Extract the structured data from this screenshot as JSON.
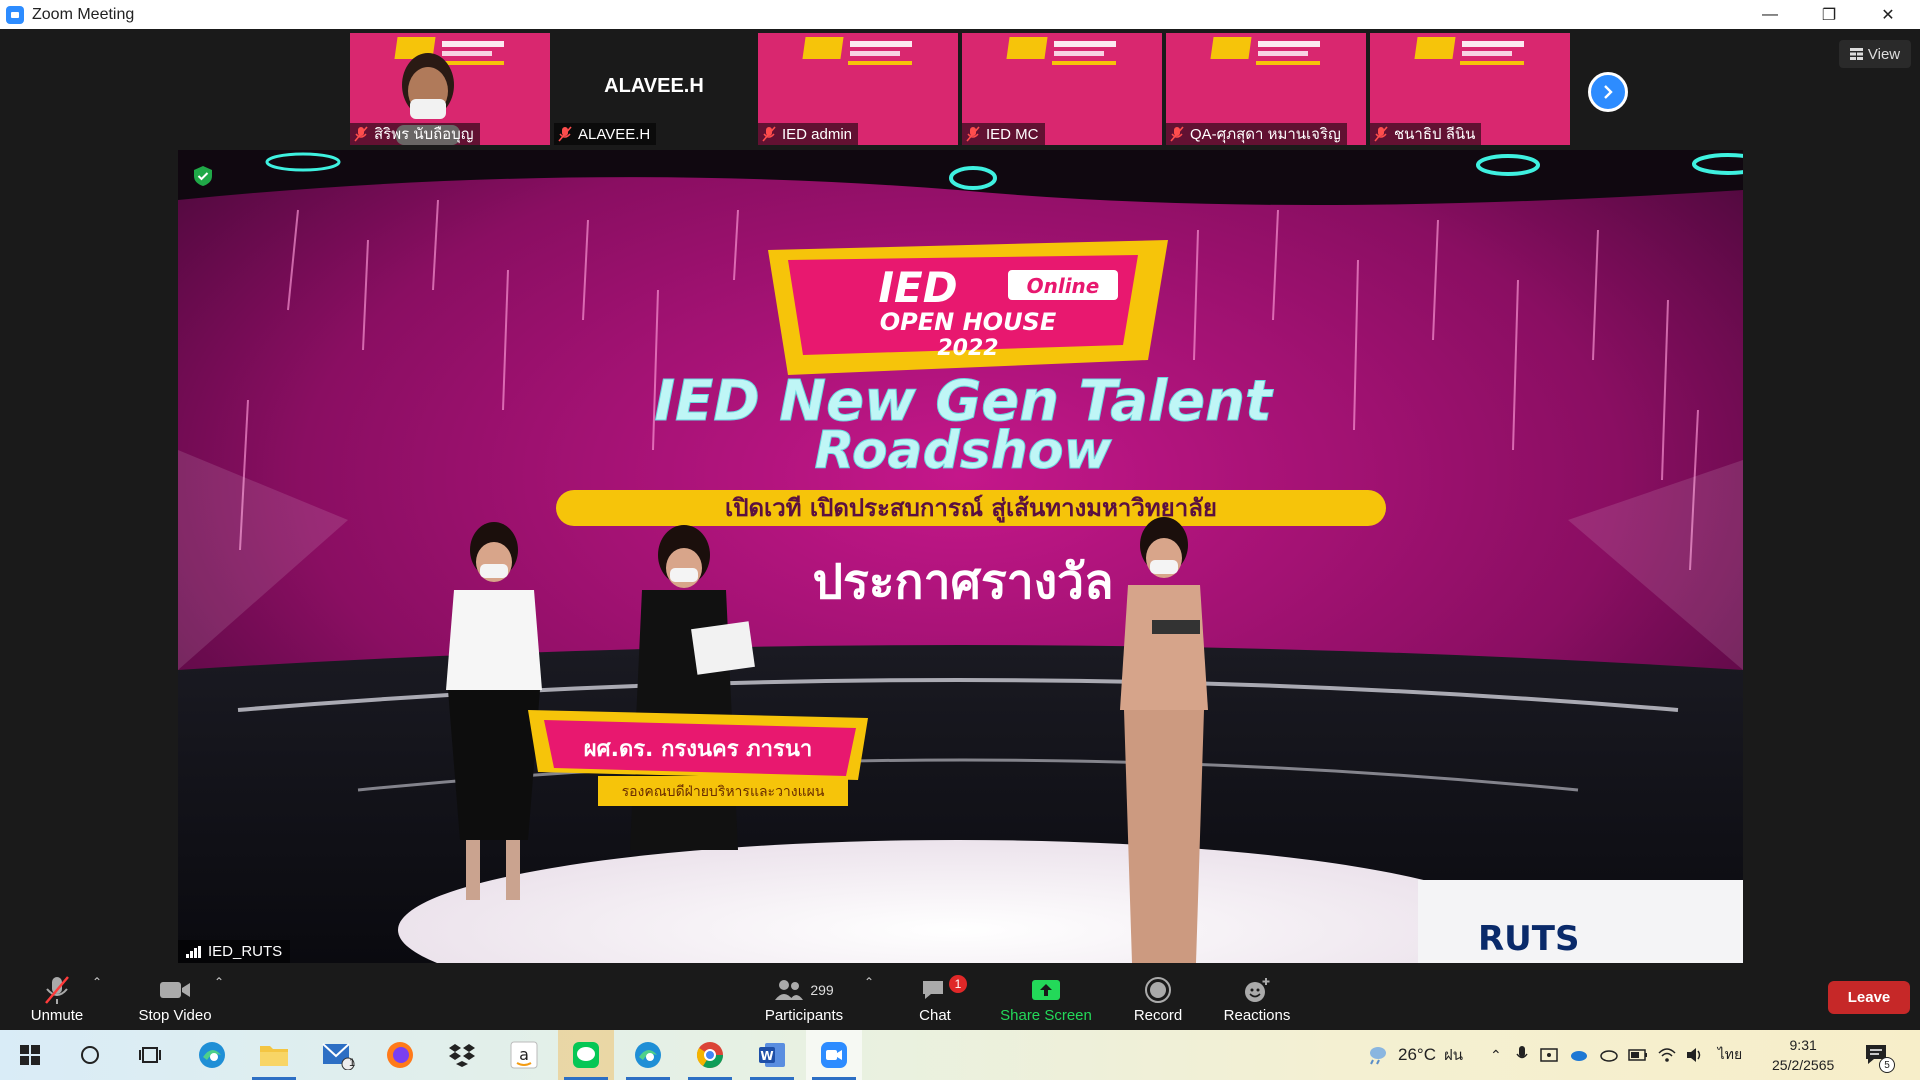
{
  "window": {
    "title": "Zoom Meeting",
    "minimize": "—",
    "restore": "❐",
    "close": "✕"
  },
  "view_button": {
    "label": "View"
  },
  "participants_strip": [
    {
      "name": "สิริพร นับถือบุญ",
      "kind": "face"
    },
    {
      "name": "ALAVEE.H",
      "kind": "name",
      "big_name": "ALAVEE.H"
    },
    {
      "name": "IED admin",
      "kind": "slide"
    },
    {
      "name": "IED MC",
      "kind": "slide"
    },
    {
      "name": "QA-ศุภสุดา หมานเจริญ",
      "kind": "slide"
    },
    {
      "name": "ชนาธิป ลีนิน",
      "kind": "slide"
    }
  ],
  "active_speaker": {
    "name": "IED_RUTS"
  },
  "stream_text": {
    "logo_main": "IED",
    "logo_tag": "Online",
    "logo_sub": "OPEN HOUSE",
    "logo_year": "2022",
    "headline_1": "IED New Gen Talent",
    "headline_2": "Roadshow",
    "banner": "เปิดเวที เปิดประสบการณ์ สู่เส้นทางมหาวิทยาลัย",
    "announce": "ประกาศรางวัล",
    "lower_third_name": "ผศ.ดร. กรงนคร ภารนา",
    "lower_third_role": "รองคณบดีฝ่ายบริหารและวางแผน",
    "corner_logo": "RUTS"
  },
  "toolbar": {
    "unmute": "Unmute",
    "stop_video": "Stop Video",
    "participants": "Participants",
    "participant_count": "299",
    "chat": "Chat",
    "chat_badge": "1",
    "share_screen": "Share Screen",
    "record": "Record",
    "reactions": "Reactions",
    "leave": "Leave"
  },
  "taskbar": {
    "mail_badge": "1",
    "weather_temp": "26°C",
    "weather_desc": "ฝน",
    "language": "ไทย",
    "time": "9:31",
    "date": "25/2/2565",
    "notification_count": "5"
  },
  "colors": {
    "zoom_blue": "#2d8cff",
    "leave_red": "#c62828",
    "share_green": "#23d959",
    "stage_magenta": "#b0157a",
    "yellow": "#f6c40a"
  }
}
